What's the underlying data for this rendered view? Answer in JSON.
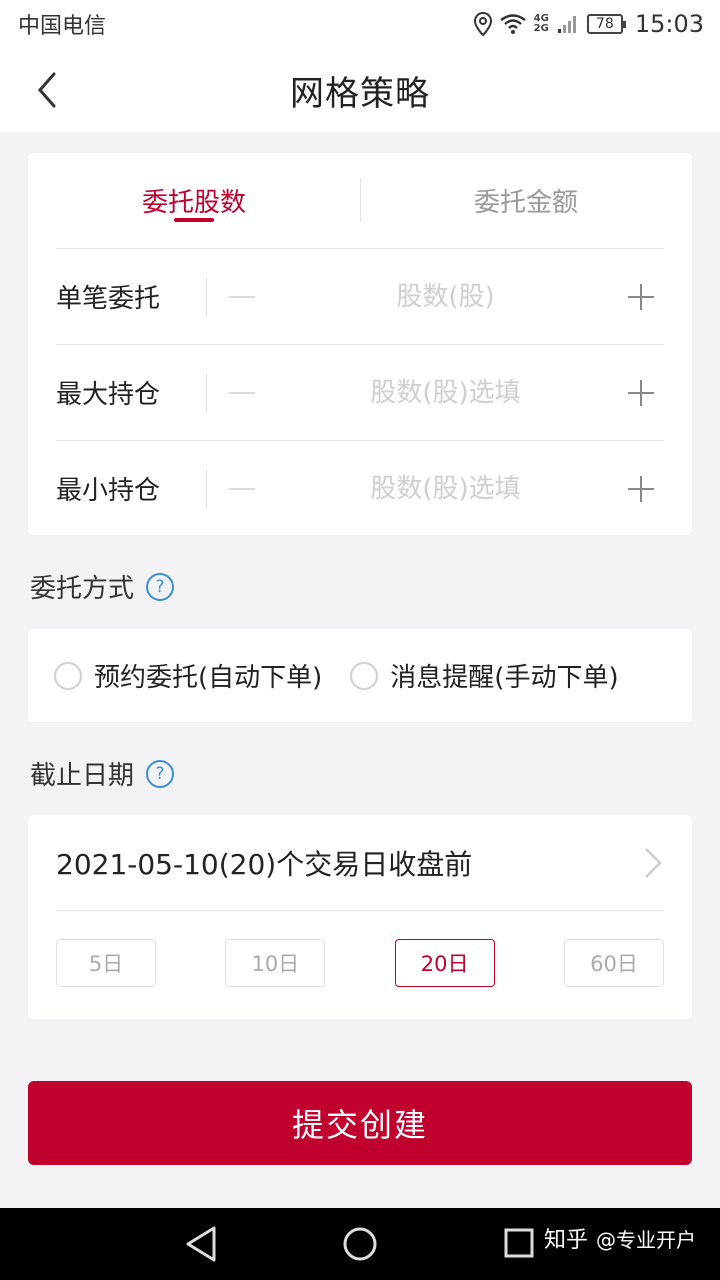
{
  "status_bar": {
    "carrier": "中国电信",
    "network_top": "4G",
    "network_bottom": "2G",
    "battery": "78",
    "time": "15:03"
  },
  "nav": {
    "title": "网格策略"
  },
  "tabs": [
    {
      "label": "委托股数",
      "active": true
    },
    {
      "label": "委托金额",
      "active": false
    }
  ],
  "rows": [
    {
      "label": "单笔委托",
      "placeholder": "股数(股)"
    },
    {
      "label": "最大持仓",
      "placeholder": "股数(股)选填"
    },
    {
      "label": "最小持仓",
      "placeholder": "股数(股)选填"
    }
  ],
  "method": {
    "title": "委托方式",
    "help": "?",
    "options": [
      {
        "label": "预约委托(自动下单)"
      },
      {
        "label": "消息提醒(手动下单)"
      }
    ]
  },
  "deadline": {
    "title": "截止日期",
    "help": "?",
    "value": "2021-05-10(20)个交易日收盘前",
    "chips": [
      {
        "label": "5日",
        "active": false
      },
      {
        "label": "10日",
        "active": false
      },
      {
        "label": "20日",
        "active": true
      },
      {
        "label": "60日",
        "active": false
      }
    ]
  },
  "submit_label": "提交创建",
  "watermark": {
    "brand": "知乎",
    "author": "@专业开户"
  },
  "colors": {
    "accent": "#c0002d",
    "help": "#3a8fd6"
  }
}
